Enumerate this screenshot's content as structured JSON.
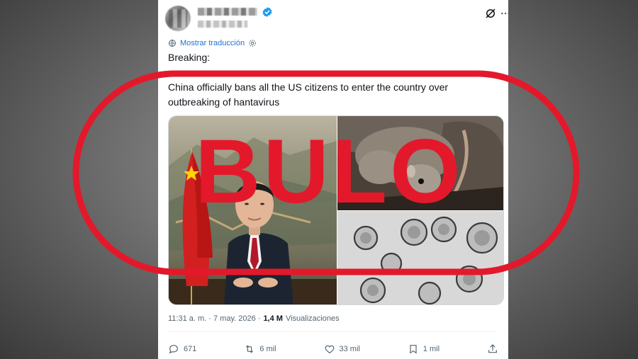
{
  "post": {
    "translate_label": "Mostrar traducción",
    "text_line1": "Breaking:",
    "text_line2": "China officially bans all the US citizens to enter the country over outbreaking of hantavirus",
    "timestamp": "11:31 a. m. · 7 may. 2026 ·",
    "views_count": "1,4 M",
    "views_label": "Visualizaciones"
  },
  "actions": {
    "replies": "671",
    "reposts": "6 mil",
    "likes": "33 mil",
    "bookmarks": "1 mil"
  },
  "stamp": {
    "label": "BULO",
    "color": "#e3192b"
  },
  "colors": {
    "link": "#1d70d8",
    "verified": "#1d9bf0",
    "muted": "#536471"
  },
  "icons": [
    "verified-badge-icon",
    "grok-icon",
    "more-icon",
    "translate-settings-icon",
    "reply-icon",
    "repost-icon",
    "like-icon",
    "bookmark-icon",
    "share-icon"
  ]
}
